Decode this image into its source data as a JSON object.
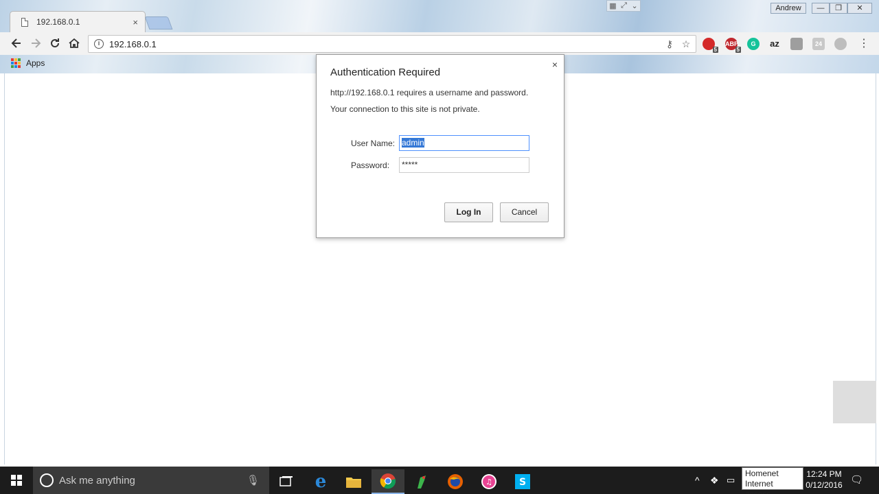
{
  "browser": {
    "tab_title": "192.168.0.1",
    "tab_close": "×",
    "url": "192.168.0.1",
    "bookmarks_apps": "Apps",
    "user_name": "Andrew",
    "extensions": [
      {
        "name": "ublock-icon",
        "label": "",
        "badge": "5",
        "color": "#d42a2a"
      },
      {
        "name": "adblock-plus-icon",
        "label": "ABP",
        "badge": "5",
        "color": "#c0272d"
      },
      {
        "name": "grammarly-icon",
        "label": "G",
        "badge": "",
        "color": "#15c39a"
      },
      {
        "name": "az-icon",
        "label": "az",
        "badge": "",
        "color": "#f2f2f2"
      },
      {
        "name": "extension-icon",
        "label": "",
        "badge": "",
        "color": "#9e9e9e"
      },
      {
        "name": "extension-24-icon",
        "label": "24",
        "badge": "",
        "color": "#c8c8c8"
      },
      {
        "name": "puzzle-icon",
        "label": "",
        "badge": "",
        "color": "#bdbdbd"
      }
    ]
  },
  "dialog": {
    "title": "Authentication Required",
    "message_line1": "http://192.168.0.1 requires a username and password.",
    "message_line2": "Your connection to this site is not private.",
    "username_label": "User Name:",
    "username_value": "admin",
    "password_label": "Password:",
    "password_value": "*****",
    "login_label": "Log In",
    "cancel_label": "Cancel",
    "close_label": "×"
  },
  "taskbar": {
    "search_placeholder": "Ask me anything",
    "network_name": "Homenet",
    "network_status": "Internet access",
    "time": "12:24 PM",
    "date": "0/12/2016"
  }
}
